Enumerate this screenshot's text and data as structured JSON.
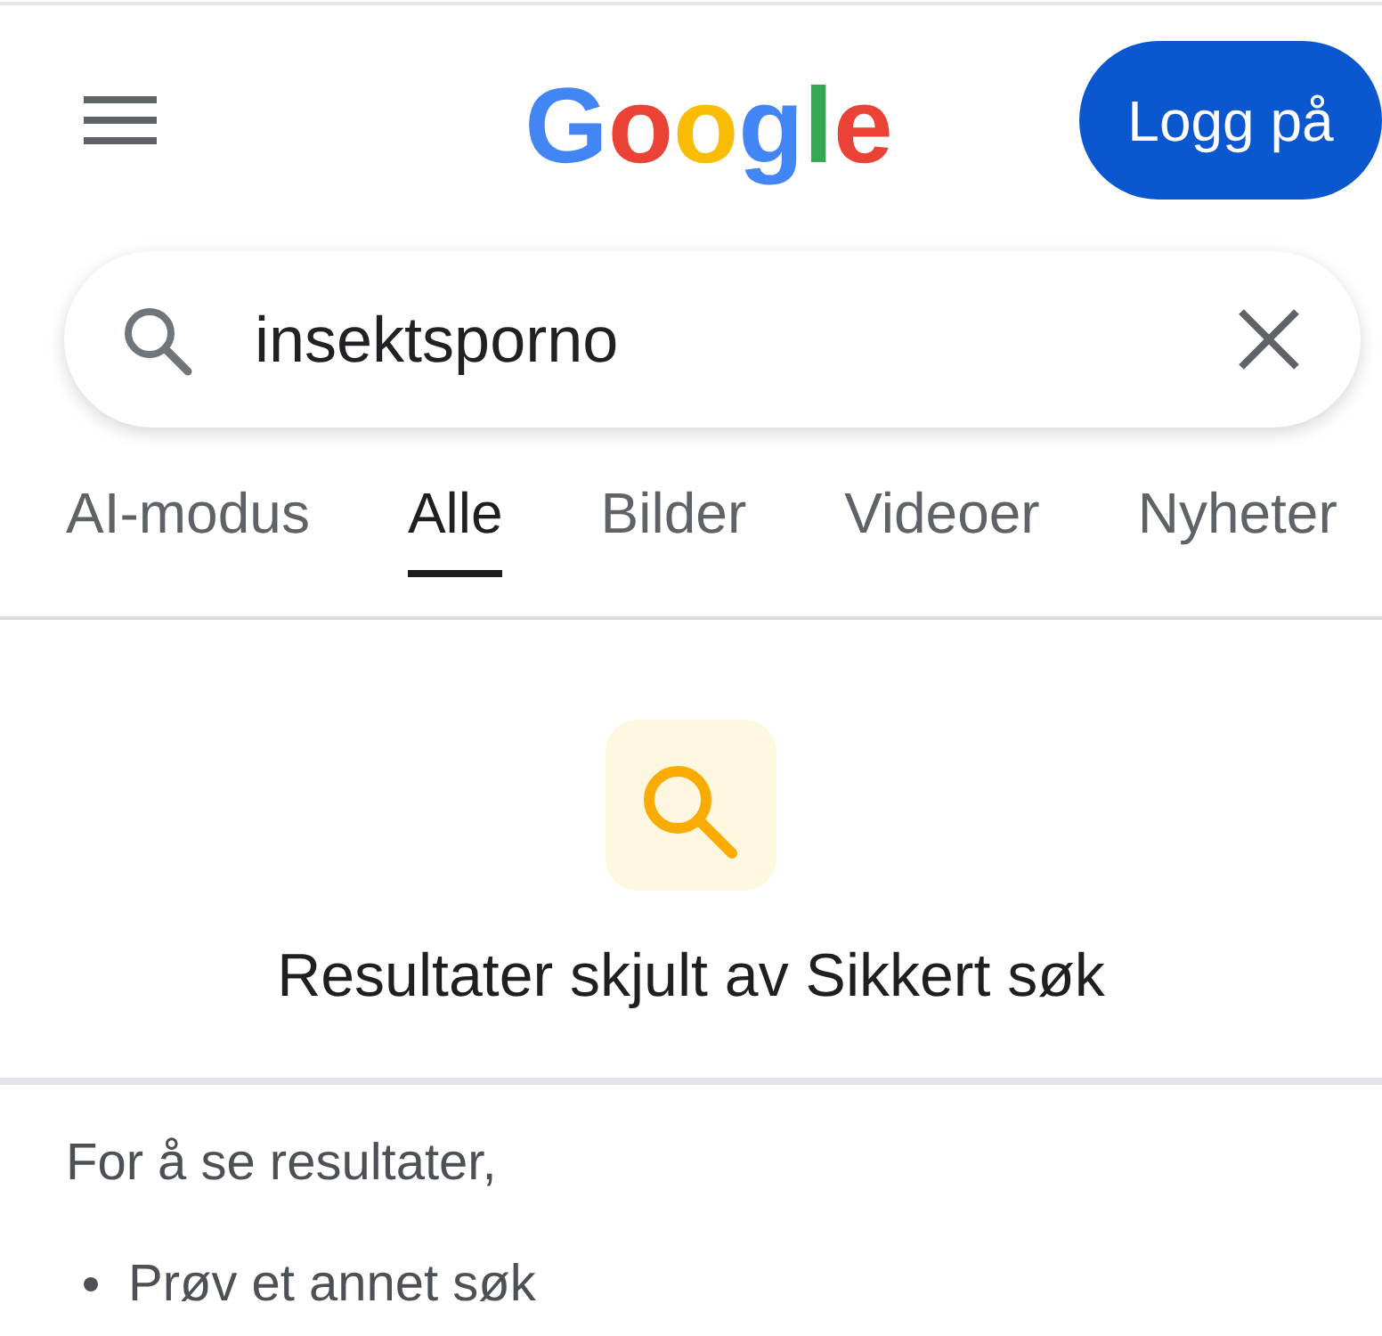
{
  "header": {
    "logo": "Google",
    "sign_in_button": "Logg på"
  },
  "search": {
    "value": "insektsporno"
  },
  "tabs": [
    {
      "label": "AI-modus",
      "selected": false
    },
    {
      "label": "Alle",
      "selected": true
    },
    {
      "label": "Bilder",
      "selected": false
    },
    {
      "label": "Videoer",
      "selected": false
    },
    {
      "label": "Nyheter",
      "selected": false
    }
  ],
  "safe_search_notice": {
    "title": "Resultater skjult av Sikkert søk"
  },
  "help": {
    "intro": "For å se resultater,",
    "suggestions": [
      "Prøv et annet søk"
    ]
  }
}
